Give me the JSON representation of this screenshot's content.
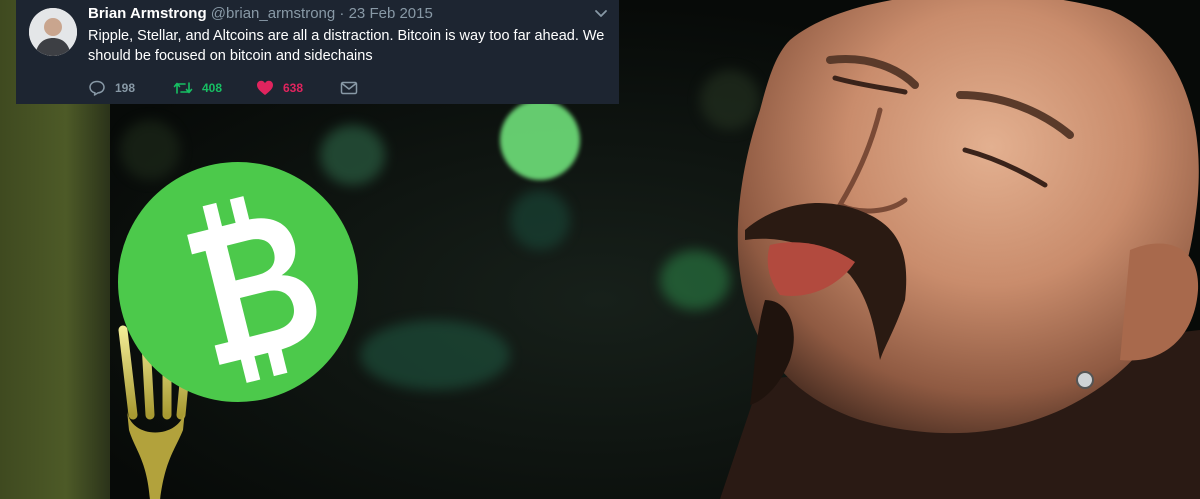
{
  "tweet": {
    "author_name": "Brian Armstrong",
    "handle": "@brian_armstrong",
    "separator": "·",
    "date": "23 Feb 2015",
    "text": "Ripple, Stellar, and Altcoins are all a distraction. Bitcoin is way too far ahead. We should be focused on bitcoin and sidechains",
    "replies": "198",
    "retweets": "408",
    "likes": "638"
  },
  "icons": {
    "reply": "speech-bubble-icon",
    "retweet": "retweet-icon",
    "like": "heart-icon",
    "message": "envelope-icon",
    "caret": "chevron-down-icon",
    "logo": "bitcoin-cash-logo"
  },
  "colors": {
    "tweet_bg": "#1d2531",
    "muted": "#8899a6",
    "retweet": "#17bf63",
    "like": "#e0245e",
    "bitcoin_green": "#4cc94b"
  }
}
